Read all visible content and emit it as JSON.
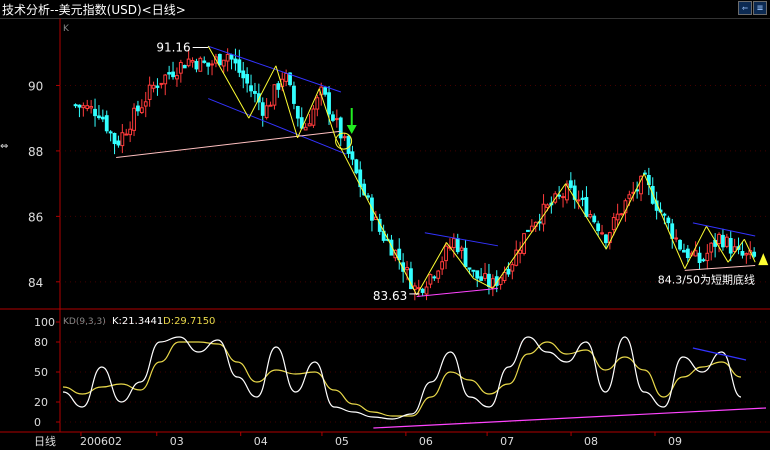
{
  "title": "技术分析--美元指数(USD)<日线>",
  "toolbar": {
    "left_icon": "arrow-left-box-icon",
    "menu_icon": "menu-list-icon",
    "right_icon": "arrow-right-box-icon"
  },
  "colors": {
    "up": "#ff3b3b",
    "down": "#33ffff",
    "trend": "#ffff33",
    "channel": "#3333ff",
    "support": "#ff44ff",
    "neckline": "#ffc0c0",
    "k_line": "#ffffff",
    "d_line": "#e8d84a",
    "axis": "#b00000"
  },
  "chart_data": [
    {
      "type": "candlestick",
      "panel_label": "K",
      "period": "日线",
      "x_tick_labels": [
        "200602",
        "03",
        "04",
        "05",
        "06",
        "07",
        "08",
        "09"
      ],
      "y_tick_labels": [
        "90",
        "88",
        "86",
        "84"
      ],
      "ylim": [
        83.2,
        92.0
      ],
      "annotations": {
        "high": "91.16",
        "low": "83.63",
        "note": "84.3/50为短期底线"
      },
      "signals": [
        "down-arrow green near 88.5 (early May)",
        "up-arrow yellow near 84.7 (Sept)"
      ],
      "series_approx": [
        {
          "date": "2006-01-30",
          "close": 89.4
        },
        {
          "date": "2006-02-08",
          "close": 89.2
        },
        {
          "date": "2006-02-14",
          "close": 88.2
        },
        {
          "date": "2006-02-20",
          "close": 89.0
        },
        {
          "date": "2006-02-28",
          "close": 90.0
        },
        {
          "date": "2006-03-06",
          "close": 90.4
        },
        {
          "date": "2006-03-13",
          "close": 90.8
        },
        {
          "date": "2006-03-20",
          "close": 90.6
        },
        {
          "date": "2006-03-27",
          "close": 91.0
        },
        {
          "date": "2006-04-03",
          "close": 90.1
        },
        {
          "date": "2006-04-10",
          "close": 89.2
        },
        {
          "date": "2006-04-17",
          "close": 90.4
        },
        {
          "date": "2006-04-24",
          "close": 88.6
        },
        {
          "date": "2006-05-01",
          "close": 89.8
        },
        {
          "date": "2006-05-08",
          "close": 88.5
        },
        {
          "date": "2006-05-15",
          "close": 87.0
        },
        {
          "date": "2006-05-22",
          "close": 85.6
        },
        {
          "date": "2006-05-29",
          "close": 84.8
        },
        {
          "date": "2006-06-05",
          "close": 83.7
        },
        {
          "date": "2006-06-12",
          "close": 84.4
        },
        {
          "date": "2006-06-19",
          "close": 85.3
        },
        {
          "date": "2006-06-26",
          "close": 84.2
        },
        {
          "date": "2006-07-03",
          "close": 83.9
        },
        {
          "date": "2006-07-10",
          "close": 84.6
        },
        {
          "date": "2006-07-17",
          "close": 85.8
        },
        {
          "date": "2006-07-24",
          "close": 86.3
        },
        {
          "date": "2006-07-31",
          "close": 86.8
        },
        {
          "date": "2006-08-07",
          "close": 86.2
        },
        {
          "date": "2006-08-14",
          "close": 85.4
        },
        {
          "date": "2006-08-21",
          "close": 86.4
        },
        {
          "date": "2006-08-28",
          "close": 87.1
        },
        {
          "date": "2006-09-04",
          "close": 86.0
        },
        {
          "date": "2006-09-11",
          "close": 85.0
        },
        {
          "date": "2006-09-18",
          "close": 84.6
        },
        {
          "date": "2006-09-25",
          "close": 85.4
        },
        {
          "date": "2006-10-02",
          "close": 84.8
        },
        {
          "date": "2006-10-09",
          "close": 84.7
        }
      ]
    },
    {
      "type": "line",
      "panel_label": "KD(9,3,3)",
      "readout": {
        "k": "K:21.3441",
        "d": "D:29.7150"
      },
      "y_tick_labels": [
        "100",
        "80",
        "50",
        "20",
        "0"
      ],
      "ylim": [
        -8,
        108
      ],
      "series": [
        {
          "name": "K",
          "values": [
            30,
            15,
            55,
            20,
            40,
            80,
            85,
            70,
            82,
            45,
            25,
            75,
            30,
            60,
            15,
            10,
            5,
            3,
            8,
            40,
            70,
            25,
            15,
            55,
            85,
            70,
            60,
            80,
            30,
            85,
            30,
            15,
            65,
            50,
            70,
            25
          ]
        },
        {
          "name": "D",
          "values": [
            35,
            28,
            35,
            38,
            32,
            60,
            80,
            80,
            78,
            60,
            40,
            52,
            48,
            50,
            32,
            18,
            10,
            6,
            6,
            25,
            50,
            42,
            28,
            38,
            68,
            80,
            68,
            72,
            52,
            65,
            52,
            25,
            45,
            55,
            60,
            45
          ]
        }
      ]
    }
  ]
}
